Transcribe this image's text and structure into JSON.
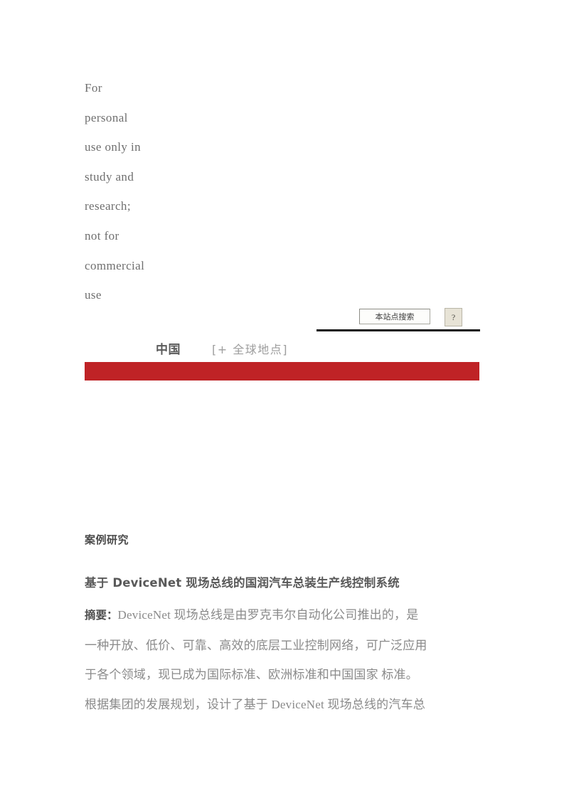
{
  "disclaimer": {
    "lines": [
      "For",
      "personal",
      "use only in",
      "study and",
      "research;",
      "not for",
      "commercial",
      "use"
    ]
  },
  "search": {
    "value": "本站点搜索",
    "placeholder": "本站点搜索",
    "help_label": "?"
  },
  "locale_nav": {
    "current": "中国",
    "global_link": "[+  全球地点]"
  },
  "banner": {
    "color": "#bf2326"
  },
  "content": {
    "section_label": "案例研究",
    "article_title": "基于 DeviceNet 现场总线的国润汽车总装生产线控制系统",
    "abstract_lead": "摘要：",
    "abstract_lines": [
      "DeviceNet 现场总线是由罗克韦尔自动化公司推出的，是",
      "一种开放、低价、可靠、高效的底层工业控制网络，可广泛应用",
      "于各个领域，现已成为国际标准、欧洲标准和中国国家  标准。",
      "根据集团的发展规划，设计了基于 DeviceNet 现场总线的汽车总"
    ]
  }
}
